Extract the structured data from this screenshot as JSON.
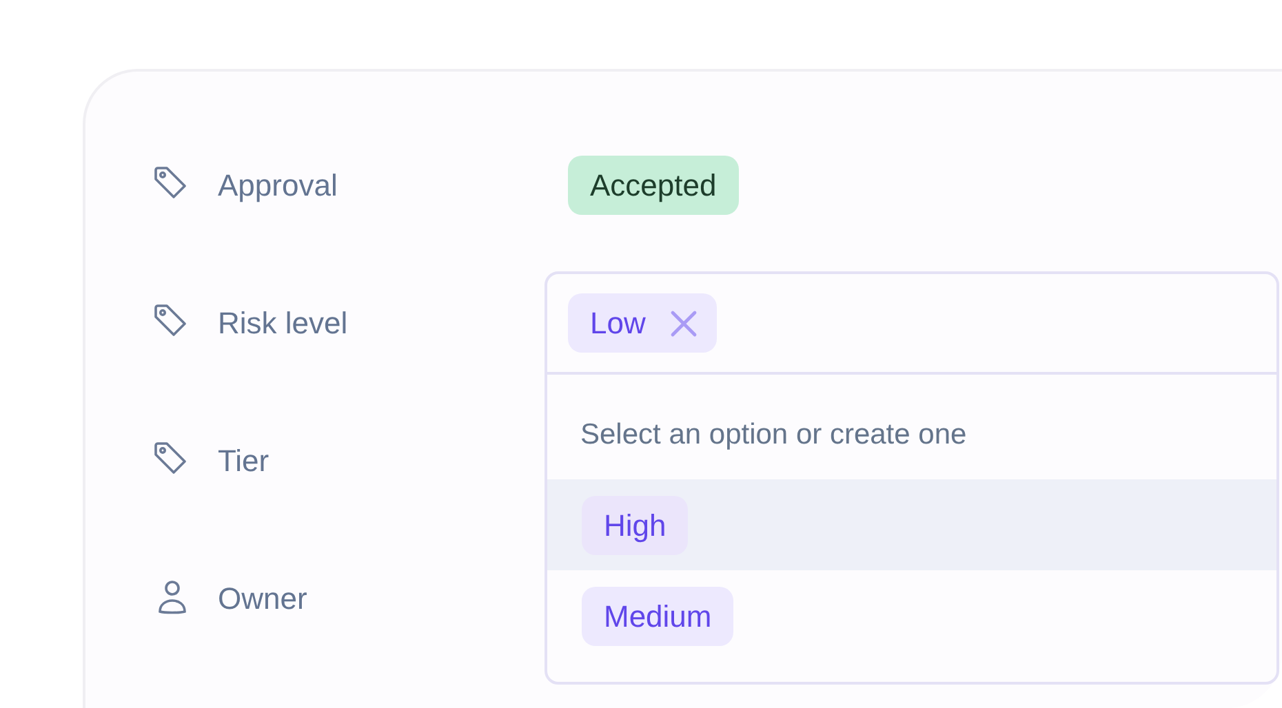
{
  "properties": [
    {
      "kind": "tag",
      "label": "Approval",
      "value": {
        "text": "Accepted",
        "color": "#c6eed8"
      }
    },
    {
      "kind": "tag",
      "label": "Risk level"
    },
    {
      "kind": "tag",
      "label": "Tier"
    },
    {
      "kind": "person",
      "label": "Owner"
    }
  ],
  "dropdown": {
    "selected_tags": [
      {
        "text": "Low",
        "removable": true
      }
    ],
    "hint": "Select an option or create one",
    "options": [
      {
        "label": "High",
        "highlighted": true
      },
      {
        "label": "Medium",
        "highlighted": false
      }
    ]
  }
}
